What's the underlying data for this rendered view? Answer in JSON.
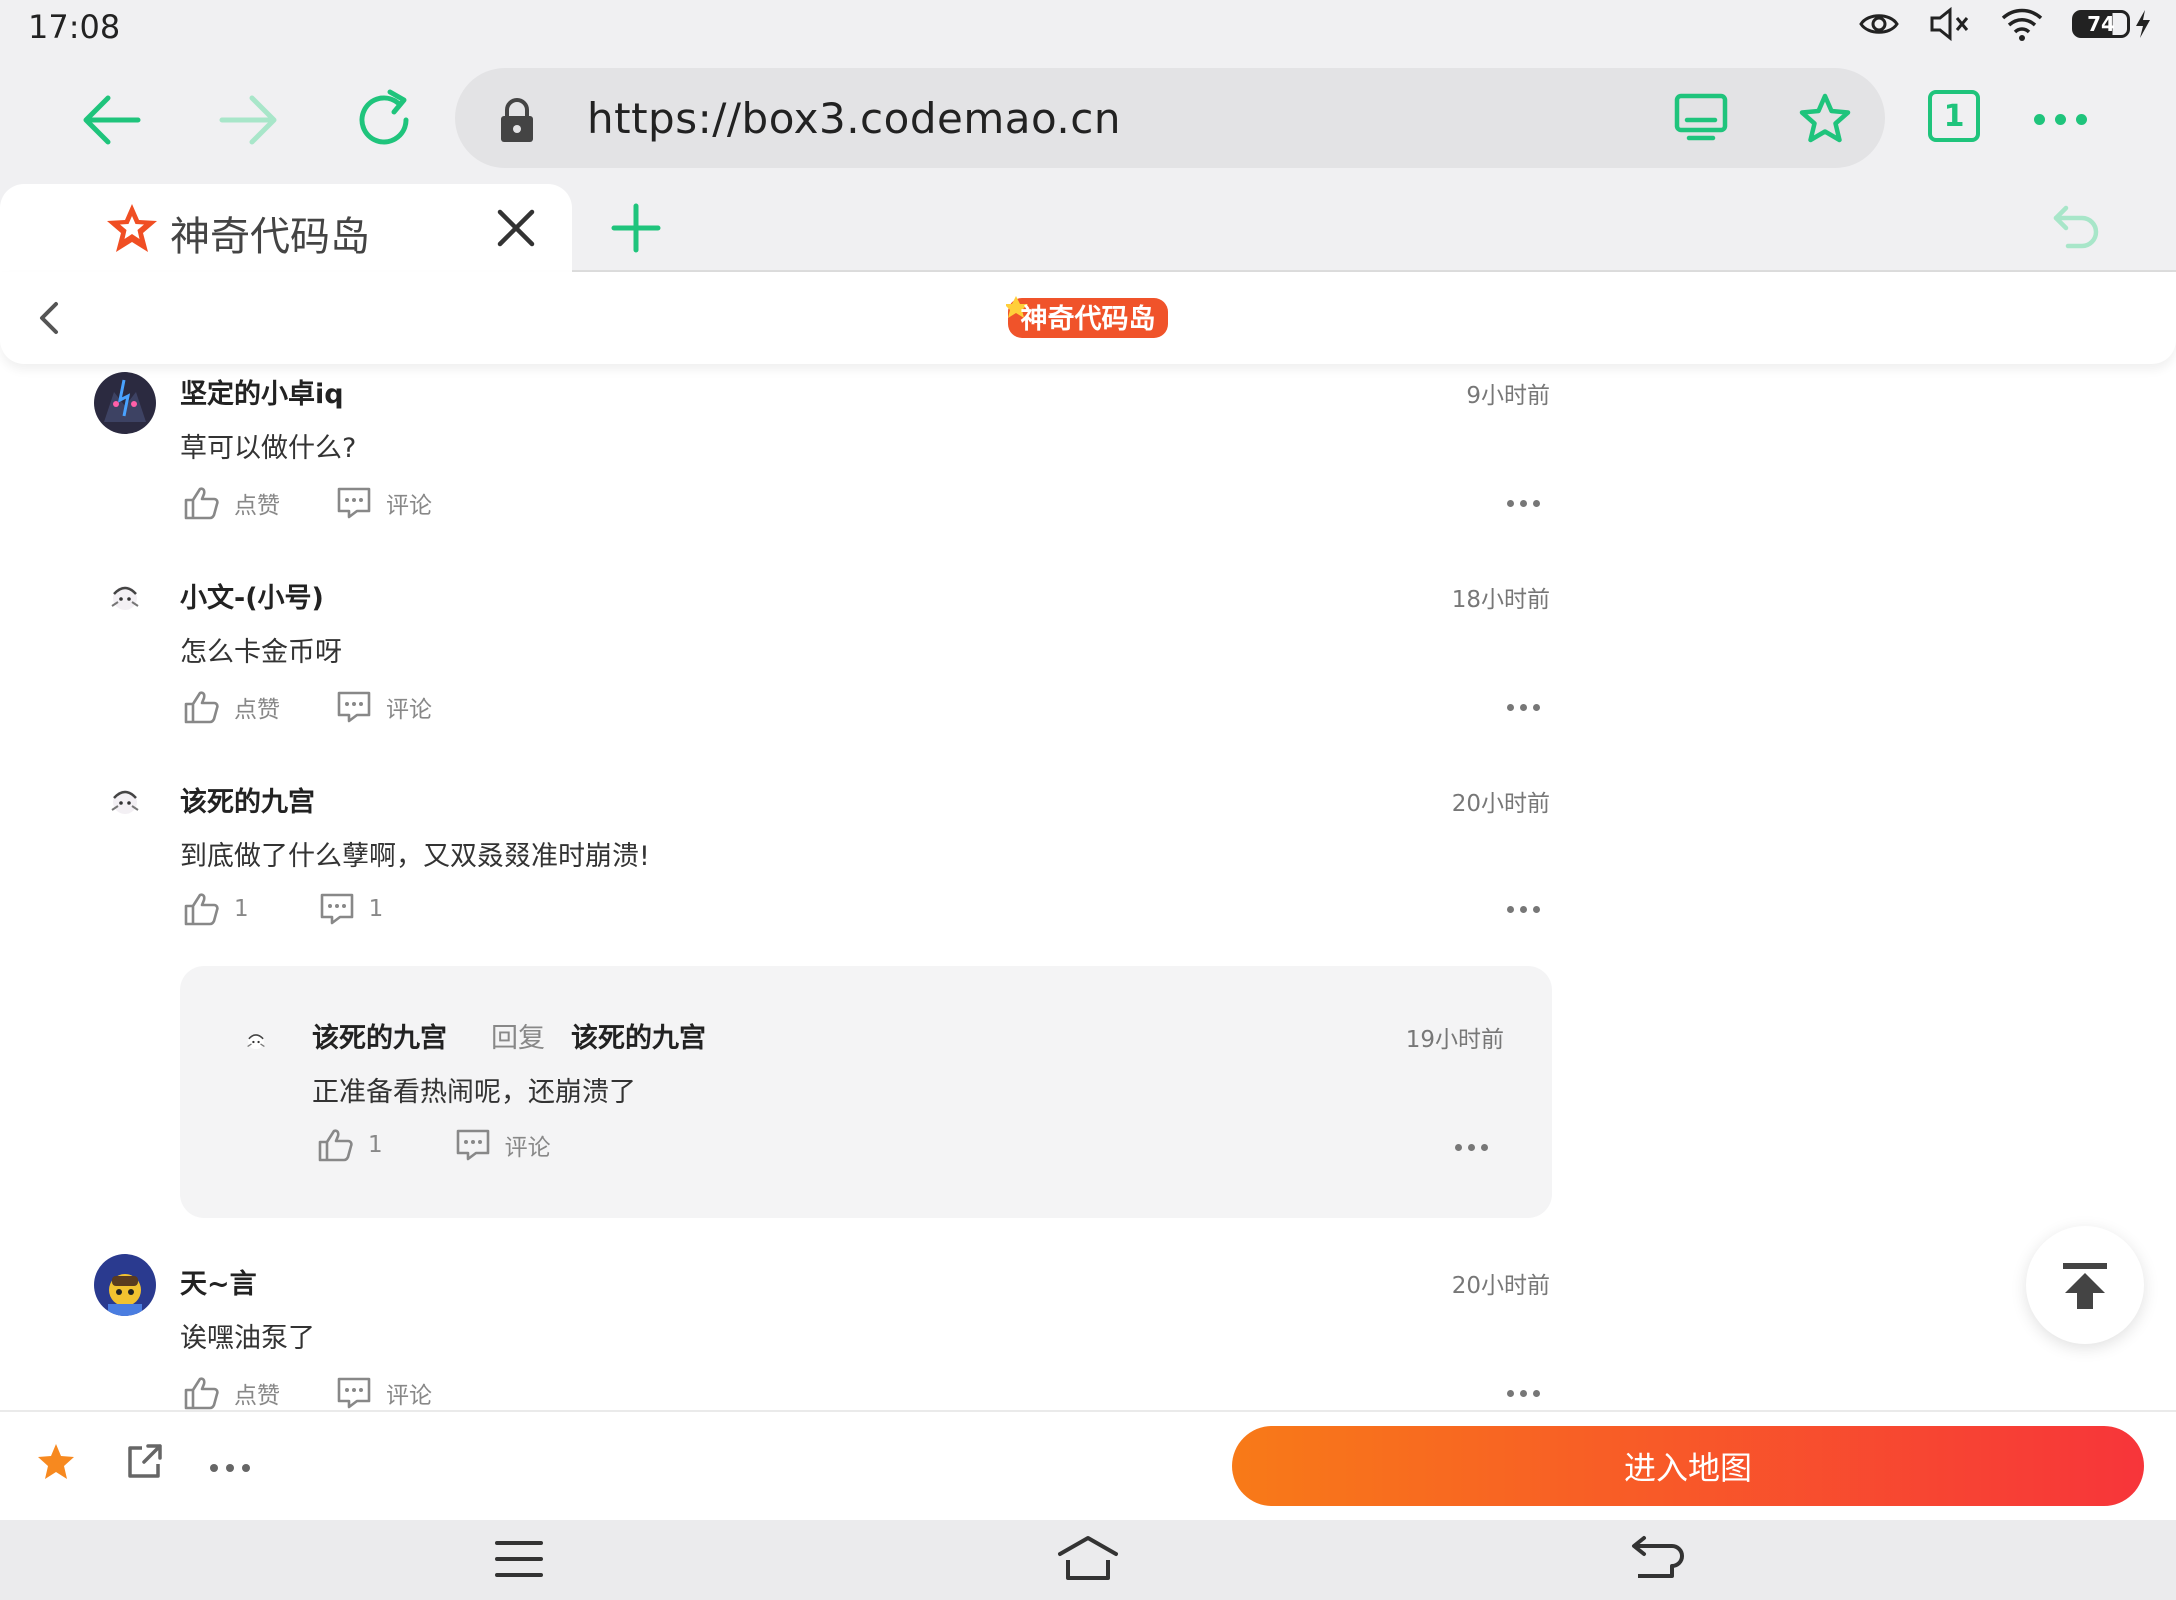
{
  "status_bar": {
    "time": "17:08",
    "battery": "74"
  },
  "browser": {
    "url": "https://box3.codemao.cn",
    "tab_count": "1",
    "active_tab_title": "神奇代码岛",
    "accent_color": "#1fc47c"
  },
  "page": {
    "logo_text": "神奇代码岛"
  },
  "comments": [
    {
      "user": "坚定的小卓iq",
      "time": "9小时前",
      "text": "草可以做什么?",
      "like_label": "点赞",
      "comment_label": "评论"
    },
    {
      "user": "小文-(小号)",
      "time": "18小时前",
      "text": "怎么卡金币呀",
      "like_label": "点赞",
      "comment_label": "评论"
    },
    {
      "user": "该死的九宫",
      "time": "20小时前",
      "text": "到底做了什么孽啊，又双叒叕准时崩溃!",
      "like_label": "1",
      "comment_label": "1",
      "reply": {
        "user": "该死的九宫",
        "reply_word": "回复",
        "reply_to": "该死的九宫",
        "time": "19小时前",
        "text": "正准备看热闹呢，还崩溃了",
        "like_label": "1",
        "comment_label": "评论"
      }
    },
    {
      "user": "天~言",
      "time": "20小时前",
      "text": "诶嘿油泵了",
      "like_label": "点赞",
      "comment_label": "评论"
    }
  ],
  "bottom_bar": {
    "enter_map_label": "进入地图",
    "star_color": "#f7891f"
  }
}
